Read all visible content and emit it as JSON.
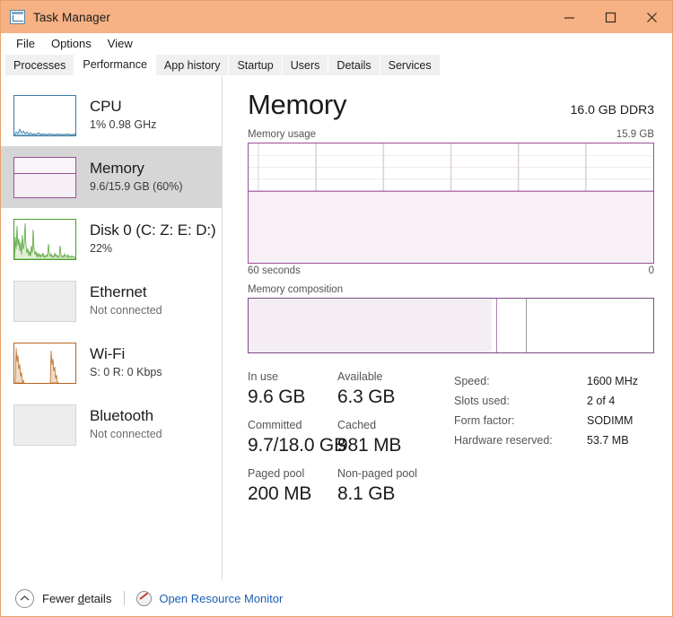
{
  "window": {
    "title": "Task Manager",
    "icon": "task-manager-icon",
    "titlebar_color": "#f6b184",
    "controls": [
      {
        "name": "minimize",
        "glyph": "minimize-icon"
      },
      {
        "name": "maximize",
        "glyph": "maximize-icon"
      },
      {
        "name": "close",
        "glyph": "close-icon"
      }
    ]
  },
  "menu": {
    "items": [
      {
        "label": "File"
      },
      {
        "label": "Options"
      },
      {
        "label": "View"
      }
    ]
  },
  "tabs": {
    "active": "Performance",
    "items": [
      {
        "label": "Processes",
        "active": false
      },
      {
        "label": "Performance",
        "active": true
      },
      {
        "label": "App history",
        "active": false
      },
      {
        "label": "Startup",
        "active": false
      },
      {
        "label": "Users",
        "active": false
      },
      {
        "label": "Details",
        "active": false
      },
      {
        "label": "Services",
        "active": false
      }
    ]
  },
  "sidebar": {
    "items": [
      {
        "title": "CPU",
        "sub": "1%  0.98 GHz",
        "selected": false,
        "muted": false,
        "graph_color": "#3a7ca5",
        "graph_fill": "#cfe2ee",
        "graph_kind": "cpu"
      },
      {
        "title": "Memory",
        "sub": "9.6/15.9 GB (60%)",
        "selected": true,
        "muted": false,
        "graph_color": "#9b4f96",
        "graph_fill": "#f6f0f6",
        "graph_kind": "memory"
      },
      {
        "title": "Disk 0 (C: Z: E: D:)",
        "sub": "22%",
        "selected": false,
        "muted": false,
        "graph_color": "#4a9c2d",
        "graph_fill": "#dff0d4",
        "graph_kind": "disk"
      },
      {
        "title": "Ethernet",
        "sub": "Not connected",
        "selected": false,
        "muted": true,
        "graph_color": "#d0d0d0",
        "graph_fill": "#ededed",
        "graph_kind": "empty"
      },
      {
        "title": "Wi-Fi",
        "sub": "S: 0 R: 0 Kbps",
        "selected": false,
        "muted": false,
        "graph_color": "#b5651d",
        "graph_fill": "#f0dcc6",
        "graph_kind": "wifi"
      },
      {
        "title": "Bluetooth",
        "sub": "Not connected",
        "selected": false,
        "muted": true,
        "graph_color": "#d0d0d0",
        "graph_fill": "#ededed",
        "graph_kind": "empty"
      }
    ]
  },
  "main": {
    "title": "Memory",
    "subtitle": "16.0 GB DDR3",
    "usage_graph": {
      "caption_left": "Memory usage",
      "caption_right": "15.9 GB",
      "axis_left": "60 seconds",
      "axis_right": "0",
      "line_color": "#9b4f96",
      "fill_color": "#f6eff6",
      "grid_color": "#e3d6e3"
    },
    "composition": {
      "caption": "Memory composition",
      "border_color": "#7c4b84",
      "fill_color": "#f4eef4",
      "in_use_percent": 60,
      "divider_percent": 61.5,
      "second_divider_percent": 68.5
    },
    "stats_left": [
      [
        {
          "label": "In use",
          "value": "9.6 GB"
        },
        {
          "label": "Available",
          "value": "6.3 GB"
        }
      ],
      [
        {
          "label": "Committed",
          "value": "9.7/18.0 GB"
        },
        {
          "label": "Cached",
          "value": "981 MB"
        }
      ],
      [
        {
          "label": "Paged pool",
          "value": "200 MB"
        },
        {
          "label": "Non-paged pool",
          "value": "8.1 GB"
        }
      ]
    ],
    "stats_right": [
      {
        "key": "Speed:",
        "value": "1600 MHz"
      },
      {
        "key": "Slots used:",
        "value": "2 of 4"
      },
      {
        "key": "Form factor:",
        "value": "SODIMM"
      },
      {
        "key": "Hardware reserved:",
        "value": "53.7 MB"
      }
    ]
  },
  "footer": {
    "fewer_details_prefix": "Fewer ",
    "fewer_details_accel": "d",
    "fewer_details_suffix": "etails",
    "resource_monitor": "Open Resource Monitor",
    "link_color": "#1a5fb4"
  },
  "chart_data": {
    "type": "area",
    "title": "Memory usage",
    "xlabel": "60 seconds",
    "ylabel": "",
    "ylim": [
      0,
      15.9
    ],
    "y_max_label": "15.9 GB",
    "y_min_label": "0",
    "x_span_seconds": 60,
    "grid": true,
    "grid_columns": 6,
    "grid_rows": 10,
    "series": [
      {
        "name": "Memory in use (GB)",
        "color": "#9b4f96",
        "values": [
          9.6,
          9.6,
          9.6,
          9.6,
          9.6,
          9.6,
          9.6,
          9.6,
          9.6,
          9.6,
          9.6,
          9.6,
          9.6,
          9.6,
          9.6,
          9.6,
          9.6,
          9.6,
          9.6,
          9.6,
          9.6,
          9.6,
          9.6,
          9.6,
          9.6,
          9.6,
          9.6,
          9.6,
          9.6,
          9.6,
          9.6,
          9.6,
          9.6,
          9.6,
          9.6,
          9.6,
          9.6,
          9.6,
          9.6,
          9.6,
          9.6,
          9.6,
          9.6,
          9.6,
          9.6,
          9.6,
          9.6,
          9.6,
          9.6,
          9.6,
          9.6,
          9.6,
          9.6,
          9.6,
          9.6,
          9.6,
          9.6,
          9.6,
          9.6,
          9.6
        ]
      }
    ]
  }
}
